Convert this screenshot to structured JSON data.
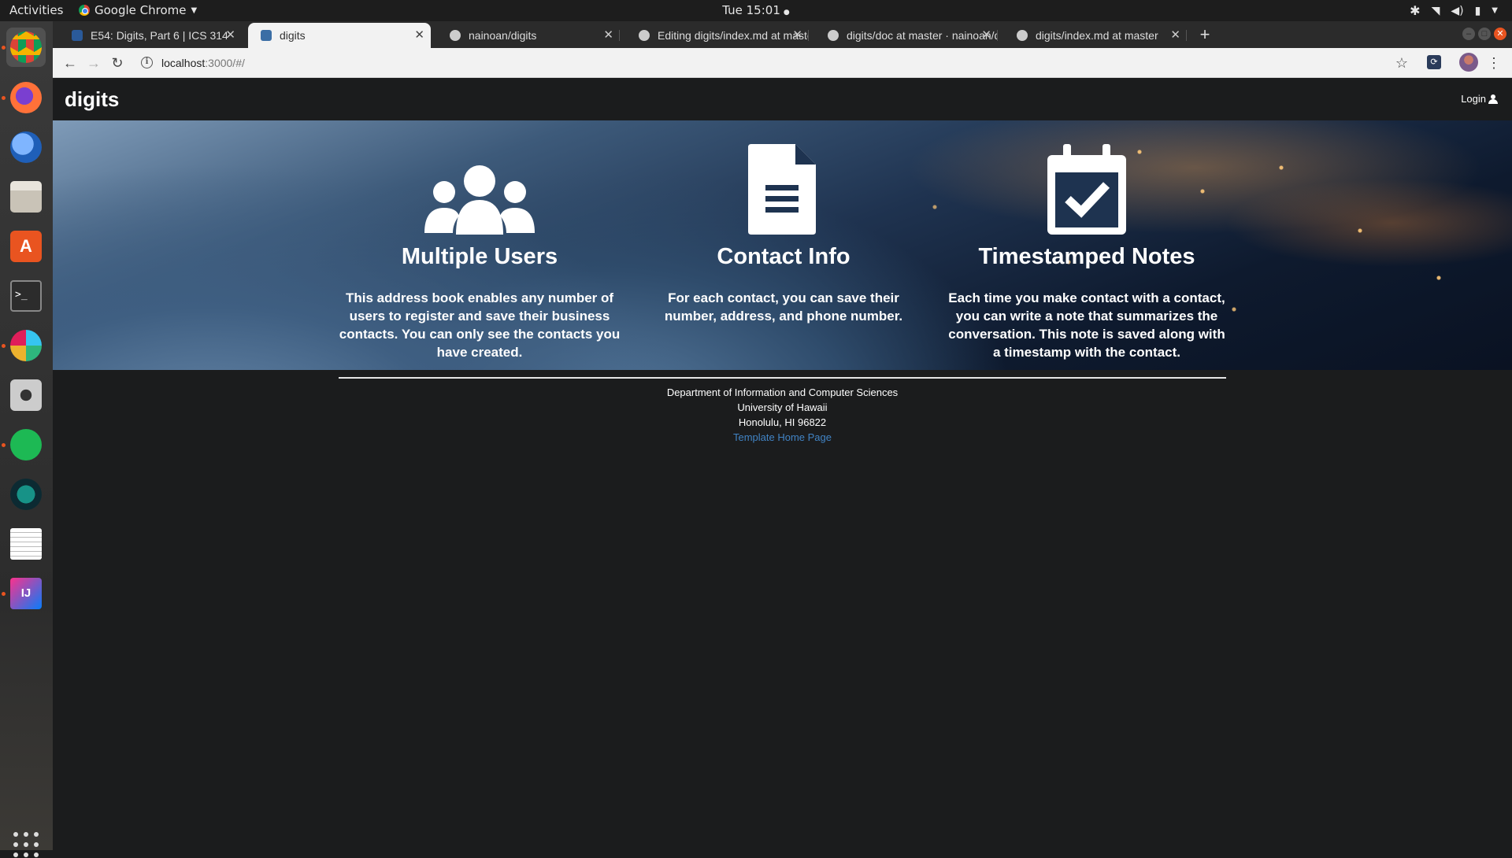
{
  "topbar": {
    "activities": "Activities",
    "app_name": "Google Chrome",
    "clock": "Tue 15:01"
  },
  "dock": {
    "items": [
      "chrome-icon",
      "firefox-icon",
      "thunderbird-icon",
      "files-icon",
      "software-center-icon",
      "terminal-icon",
      "slack-icon",
      "screenshot-icon",
      "spotify-icon",
      "gitkraken-icon",
      "text-editor-icon",
      "intellij-icon"
    ]
  },
  "browser": {
    "tabs": [
      {
        "label": "E54: Digits, Part 6 | ICS 314",
        "active": false
      },
      {
        "label": "digits",
        "active": true
      },
      {
        "label": "nainoan/digits",
        "active": false
      },
      {
        "label": "Editing digits/index.md at master",
        "active": false
      },
      {
        "label": "digits/doc at master · nainoan/digits",
        "active": false
      },
      {
        "label": "digits/index.md at master",
        "active": false
      }
    ],
    "url_host": "localhost",
    "url_path": ":3000/#/"
  },
  "navbar": {
    "brand": "digits",
    "login": "Login"
  },
  "features": [
    {
      "icon": "users-icon",
      "title": "Multiple Users",
      "text": "This address book enables any number of users to register and save their business contacts. You can only see the contacts you have created."
    },
    {
      "icon": "file-text-icon",
      "title": "Contact Info",
      "text": "For each contact, you can save their number, address, and phone number."
    },
    {
      "icon": "calendar-check-icon",
      "title": "Timestamped Notes",
      "text": "Each time you make contact with a contact, you can write a note that summarizes the conversation. This note is saved along with a timestamp with the contact."
    }
  ],
  "footer": {
    "line1": "Department of Information and Computer Sciences",
    "line2": "University of Hawaii",
    "line3": "Honolulu, HI 96822",
    "link": "Template Home Page"
  },
  "colors": {
    "page_bg": "#1b1c1d",
    "ubuntu_orange": "#e95420",
    "link": "#4183c4"
  }
}
